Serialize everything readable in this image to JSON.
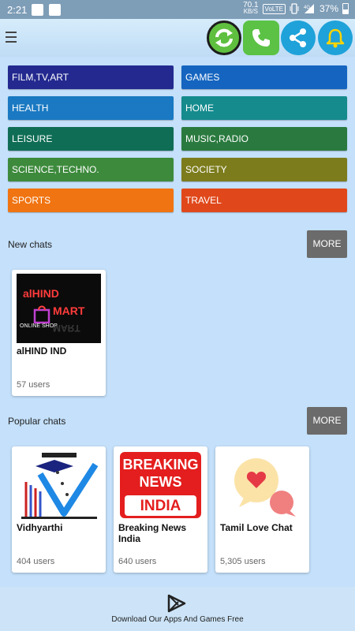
{
  "status": {
    "time": "2:21",
    "speed_value": "70.1",
    "speed_unit": "KB/S",
    "volte": "VoLTE",
    "network": "4G",
    "battery": "37%"
  },
  "topbar": {
    "menu_icon": "hamburger-icon",
    "buttons": [
      "refresh-icon",
      "phone-icon",
      "share-icon",
      "bell-icon"
    ]
  },
  "categories": [
    {
      "label": "FILM,TV,ART",
      "color": "#23298f"
    },
    {
      "label": "GAMES",
      "color": "#1565c0"
    },
    {
      "label": "HEALTH",
      "color": "#1a79c2"
    },
    {
      "label": "HOME",
      "color": "#158b8e"
    },
    {
      "label": "LEISURE",
      "color": "#0f6d55"
    },
    {
      "label": "MUSIC,RADIO",
      "color": "#2a7a3f"
    },
    {
      "label": "SCIENCE,TECHNO.",
      "color": "#3d8a3c"
    },
    {
      "label": "SOCIETY",
      "color": "#7c7c1d"
    },
    {
      "label": "SPORTS",
      "color": "#f07412"
    },
    {
      "label": "TRAVEL",
      "color": "#e0481b"
    }
  ],
  "new_chats": {
    "title": "New chats",
    "more": "MORE",
    "items": [
      {
        "name": "alHIND IND",
        "users": "57 users",
        "thumb_title": "alHIND",
        "thumb_sub": "MART",
        "thumb_tag": "ONLINE SHOP"
      }
    ]
  },
  "popular_chats": {
    "title": "Popular chats",
    "more": "MORE",
    "items": [
      {
        "name": "Vidhyarthi",
        "users": "404 users"
      },
      {
        "name": "Breaking News India",
        "users": "640 users",
        "thumb_l1": "BREAKING",
        "thumb_l2": "NEWS",
        "thumb_l3": "INDIA"
      },
      {
        "name": "Tamil Love Chat",
        "users": "5,305 users"
      }
    ]
  },
  "footer": {
    "text": "Download Our Apps And Games Free"
  }
}
